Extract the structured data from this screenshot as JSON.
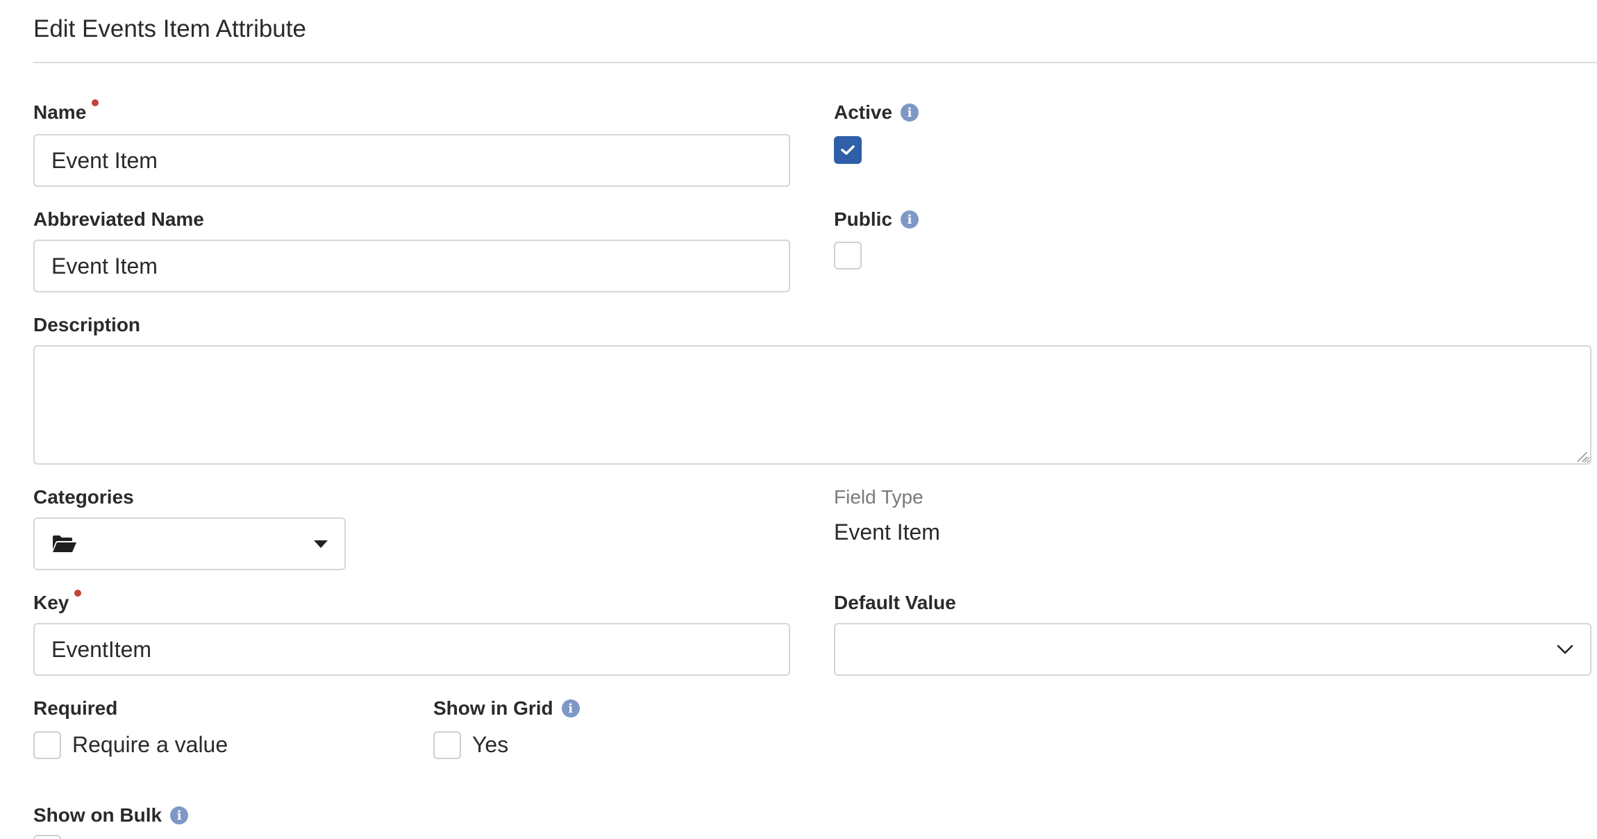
{
  "page": {
    "title": "Edit Events Item Attribute"
  },
  "form": {
    "name": {
      "label": "Name",
      "value": "Event Item"
    },
    "abbreviated_name": {
      "label": "Abbreviated Name",
      "value": "Event Item"
    },
    "description": {
      "label": "Description",
      "value": ""
    },
    "categories": {
      "label": "Categories",
      "icon": "folder-open-icon"
    },
    "key": {
      "label": "Key",
      "value": "EventItem"
    },
    "active": {
      "label": "Active",
      "checked": true
    },
    "public": {
      "label": "Public",
      "checked": false
    },
    "field_type": {
      "label": "Field Type",
      "value": "Event Item"
    },
    "default_value": {
      "label": "Default Value",
      "value": ""
    },
    "required": {
      "label": "Required",
      "option_label": "Require a value",
      "checked": false
    },
    "show_in_grid": {
      "label": "Show in Grid",
      "option_label": "Yes",
      "checked": false
    },
    "show_on_bulk": {
      "label": "Show on Bulk"
    }
  },
  "colors": {
    "accent": "#2f5fa8",
    "info_icon": "#7e98c6",
    "required_dot": "#c4403a",
    "border": "#d6d6d6"
  }
}
